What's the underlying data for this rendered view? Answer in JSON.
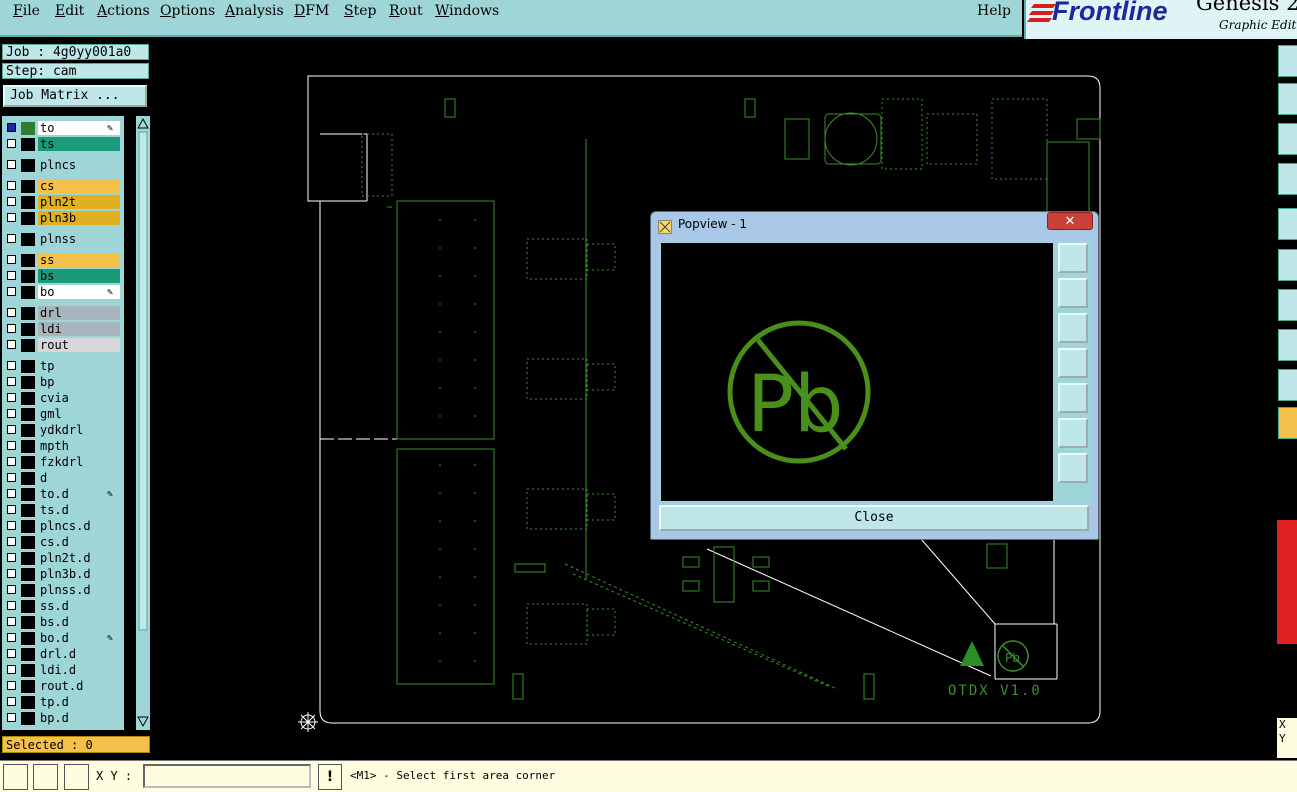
{
  "menubar": {
    "items": [
      {
        "label": "File",
        "u": "F"
      },
      {
        "label": "Edit",
        "u": "E"
      },
      {
        "label": "Actions",
        "u": "A"
      },
      {
        "label": "Options",
        "u": "O"
      },
      {
        "label": "Analysis",
        "u": "A"
      },
      {
        "label": "DFM",
        "u": "D"
      },
      {
        "label": "Step",
        "u": "S"
      },
      {
        "label": "Rout",
        "u": "R"
      },
      {
        "label": "Windows",
        "u": "W"
      }
    ],
    "help": "Help"
  },
  "logo": {
    "brand": "Frontline",
    "product": "Genesis 2",
    "subtitle": "Graphic Edit"
  },
  "job": {
    "job_label": "Job : 4g0yy001a0",
    "step_label": "Step: cam",
    "matrix_button": "Job Matrix ..."
  },
  "layers": [
    {
      "name": "to",
      "color": "#ffffff",
      "swatch": "#2e7d32",
      "checked": true,
      "edit": true
    },
    {
      "name": "ts",
      "color": "#1a9a7a",
      "swatch": "#000",
      "checked": false
    },
    {
      "name": "plncs",
      "color": "#9ed5d7",
      "swatch": "#000",
      "checked": false
    },
    {
      "name": "cs",
      "color": "#f5c04a",
      "swatch": "#000",
      "checked": false
    },
    {
      "name": "pln2t",
      "color": "#e0b020",
      "swatch": "#000",
      "checked": false
    },
    {
      "name": "pln3b",
      "color": "#e0b020",
      "swatch": "#000",
      "checked": false
    },
    {
      "name": "plnss",
      "color": "#9ed5d7",
      "swatch": "#000",
      "checked": false
    },
    {
      "name": "ss",
      "color": "#f5c04a",
      "swatch": "#000",
      "checked": false
    },
    {
      "name": "bs",
      "color": "#1a9a7a",
      "swatch": "#000",
      "checked": false
    },
    {
      "name": "bo",
      "color": "#ffffff",
      "swatch": "#000",
      "checked": false,
      "edit": true
    },
    {
      "name": "drl",
      "color": "#a8b4bc",
      "swatch": "#000",
      "checked": false
    },
    {
      "name": "ldi",
      "color": "#a8b4bc",
      "swatch": "#000",
      "checked": false
    },
    {
      "name": "rout",
      "color": "#d8d8d8",
      "swatch": "#000",
      "checked": false
    },
    {
      "name": "tp",
      "color": "#9ed5d7",
      "swatch": "#000",
      "checked": false
    },
    {
      "name": "bp",
      "color": "#9ed5d7",
      "swatch": "#000",
      "checked": false
    },
    {
      "name": "cvia",
      "color": "#9ed5d7",
      "swatch": "#000",
      "checked": false
    },
    {
      "name": "gml",
      "color": "#9ed5d7",
      "swatch": "#000",
      "checked": false
    },
    {
      "name": "ydkdrl",
      "color": "#9ed5d7",
      "swatch": "#000",
      "checked": false
    },
    {
      "name": "mpth",
      "color": "#9ed5d7",
      "swatch": "#000",
      "checked": false
    },
    {
      "name": "fzkdrl",
      "color": "#9ed5d7",
      "swatch": "#000",
      "checked": false
    },
    {
      "name": "d",
      "color": "#9ed5d7",
      "swatch": "#000",
      "checked": false
    },
    {
      "name": "to.d",
      "color": "#9ed5d7",
      "swatch": "#000",
      "checked": false,
      "edit": true
    },
    {
      "name": "ts.d",
      "color": "#9ed5d7",
      "swatch": "#000",
      "checked": false
    },
    {
      "name": "plncs.d",
      "color": "#9ed5d7",
      "swatch": "#000",
      "checked": false
    },
    {
      "name": "cs.d",
      "color": "#9ed5d7",
      "swatch": "#000",
      "checked": false
    },
    {
      "name": "pln2t.d",
      "color": "#9ed5d7",
      "swatch": "#000",
      "checked": false
    },
    {
      "name": "pln3b.d",
      "color": "#9ed5d7",
      "swatch": "#000",
      "checked": false
    },
    {
      "name": "plnss.d",
      "color": "#9ed5d7",
      "swatch": "#000",
      "checked": false
    },
    {
      "name": "ss.d",
      "color": "#9ed5d7",
      "swatch": "#000",
      "checked": false
    },
    {
      "name": "bs.d",
      "color": "#9ed5d7",
      "swatch": "#000",
      "checked": false
    },
    {
      "name": "bo.d",
      "color": "#9ed5d7",
      "swatch": "#000",
      "checked": false,
      "edit": true
    },
    {
      "name": "drl.d",
      "color": "#9ed5d7",
      "swatch": "#000",
      "checked": false
    },
    {
      "name": "ldi.d",
      "color": "#9ed5d7",
      "swatch": "#000",
      "checked": false
    },
    {
      "name": "rout.d",
      "color": "#9ed5d7",
      "swatch": "#000",
      "checked": false
    },
    {
      "name": "tp.d",
      "color": "#9ed5d7",
      "swatch": "#000",
      "checked": false
    },
    {
      "name": "bp.d",
      "color": "#9ed5d7",
      "swatch": "#000",
      "checked": false
    }
  ],
  "selected_label": "Selected : 0",
  "popview": {
    "title": "Popview - 1",
    "close_label": "Close",
    "close_x": "✕",
    "symbol_text": "Pb"
  },
  "board": {
    "marking": "OTDX V1.0",
    "marking_symbol": "Pb"
  },
  "bottom": {
    "xy_label": "X Y :",
    "xy_value": "",
    "warn": "!",
    "status": "<M1> - Select first area corner"
  },
  "right_xy": {
    "x": "X",
    "y": "Y"
  },
  "colors": {
    "panel": "#9ed5d7",
    "accent_green": "#4a8f1a",
    "board_outline": "#ffffff",
    "selected_bg": "#f5c04a"
  }
}
